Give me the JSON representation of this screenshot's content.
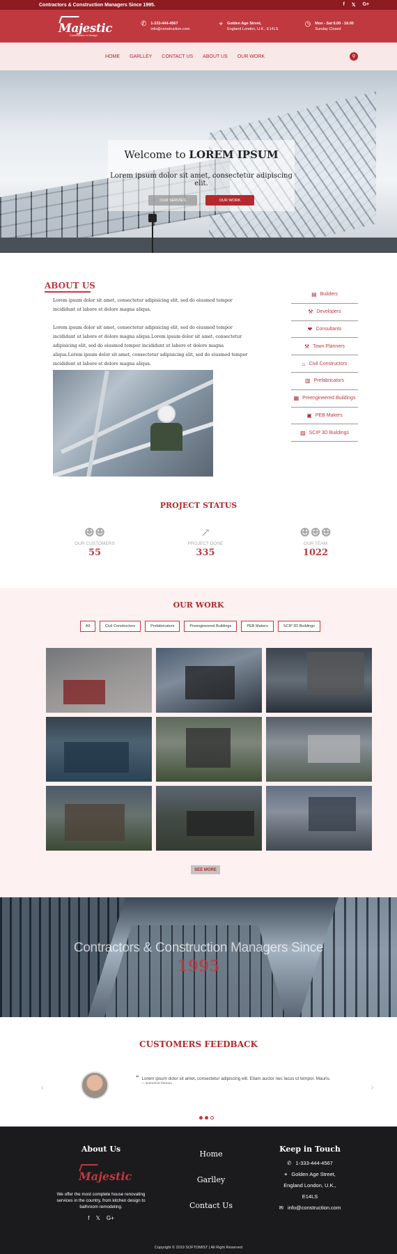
{
  "topbar": {
    "tagline": "Contractors & Construction Managers Since 1995.",
    "social": [
      "f",
      "𝕏",
      "G+"
    ]
  },
  "header": {
    "logo_text": "Majestic",
    "logo_sub": "Construction & Design",
    "phone": "1-333-444-4567",
    "email": "info@construction.com",
    "address_line1": "Golden Age Street,",
    "address_line2": "England London, U.K., E14LS",
    "hours_line1": "Mon - Sat 8.00 - 18.00",
    "hours_line2": "Sunday Closed",
    "icons": [
      "phone-icon",
      "map-pin-icon",
      "clock-icon"
    ]
  },
  "nav": {
    "items": [
      "HOME",
      "GARLLEY",
      "CONTACT US",
      "ABOUT US",
      "OUR WORK"
    ]
  },
  "hero": {
    "title_prefix": "Welcome to ",
    "title_bold": "LOREM IPSUM",
    "subtitle": "Lorem ipsum dolor sit amet, consectetur adipiscing elit.",
    "btn_services": "OUR SERVIES",
    "btn_work": "OUR WORK"
  },
  "about": {
    "title": "ABOUT US",
    "para1": "Lorem ipsum dolor sit amet, consectetur adipisicing elit, sed do eiusmod tempor incididunt ut labore et dolore magna aliqua.",
    "para2": "Lorem ipsum dolor sit amet, consectetur adipisicing elit, sed do eiusmod tempor incididunt ut labore et dolore magna aliqua.Lorem ipsum dolor sit amet, consectetur adipisicing elit, sed do eiusmod tempor incididunt ut labore et dolore magna aliqua.Lorem ipsum dolor sit amet, consectetur adipisicing elit, sed do eiusmod tempor incididunt ut labore et dolore magna aliqua.",
    "services": [
      {
        "label": "Builders",
        "icon": "building-icon",
        "glyph": "▤"
      },
      {
        "label": "Developers",
        "icon": "wrench-icon",
        "glyph": "⚒"
      },
      {
        "label": "Consultants",
        "icon": "handshake-icon",
        "glyph": "❤"
      },
      {
        "label": "Town Planners",
        "icon": "hammer-icon",
        "glyph": "⚒"
      },
      {
        "label": "Civil Constructors",
        "icon": "home-icon",
        "glyph": "⌂"
      },
      {
        "label": "Prefabricators",
        "icon": "city-icon",
        "glyph": "▥"
      },
      {
        "label": "Preengineered Buildings",
        "icon": "industry-icon",
        "glyph": "▦"
      },
      {
        "label": "PEB Makers",
        "icon": "university-icon",
        "glyph": "▣"
      },
      {
        "label": "SCIP 3D Buildings",
        "icon": "bus-icon",
        "glyph": "▧"
      }
    ]
  },
  "status": {
    "title": "PROJECT STATUS",
    "stats": [
      {
        "label": "OUR CUSTOMERS",
        "value": "55",
        "icon": "users-icon",
        "glyph": "☻☻"
      },
      {
        "label": "PROJECT DONE",
        "value": "335",
        "icon": "chart-icon",
        "glyph": "↗"
      },
      {
        "label": "OUR TEAM",
        "value": "1022",
        "icon": "team-icon",
        "glyph": "☻☻☻"
      }
    ]
  },
  "work": {
    "title": "OUR WORK",
    "filters": [
      "All",
      "Civil Constructors",
      "Prefabricators",
      "Preengineered Buildings",
      "PEB Makers",
      "SCIP 3D Buildings"
    ],
    "see_more": "SEE MORE",
    "tiles": [
      {
        "bg": "linear-gradient(160deg,#8d8f93 0%,#b9b7b5 50%,#d3d0cc 100%)",
        "accent": "#9b1c1f"
      },
      {
        "bg": "linear-gradient(160deg,#5c7189 0%,#9aaabb 40%,#2f3b48 100%)",
        "accent": "#222"
      },
      {
        "bg": "linear-gradient(180deg,#46505c 0%,#79848f 50%,#2d3540 100%)",
        "accent": "#666"
      },
      {
        "bg": "linear-gradient(180deg,#3b4b59 0%,#5a7587 40%,#2f4d63 100%)",
        "accent": "#1f3a4e"
      },
      {
        "bg": "linear-gradient(180deg,#6e7f6a 0%,#9aa394 40%,#4b5e3e 100%)",
        "accent": "#333"
      },
      {
        "bg": "linear-gradient(180deg,#66707c 0%,#a8b1ba 40%,#5e6e58 100%)",
        "accent": "#d9dcdf"
      },
      {
        "bg": "linear-gradient(180deg,#5a6b80 0%,#7d8a83 45%,#44553a 100%)",
        "accent": "#5a4a3c"
      },
      {
        "bg": "linear-gradient(180deg,#6c7a86 0%,#4d574f 50%,#3b4537 100%)",
        "accent": "#222"
      },
      {
        "bg": "linear-gradient(180deg,#7888a0 0%,#a5b0bd 40%,#4e5660 100%)",
        "accent": "#3a4451"
      }
    ]
  },
  "banner": {
    "text": "Contractors & Construction Managers Since",
    "year": "1995"
  },
  "feedback": {
    "title": "CUSTOMERS FEEDBACK",
    "quote": "Lorem ipsum dolor sit amet, consectetur adipiscing elit. Etiam auctor nec lacus ut tempor. Mauris.",
    "author": "— Someone famous",
    "quote_mark": "“",
    "prev": "‹",
    "next": "›"
  },
  "footer": {
    "about_title": "About Us",
    "about_text": "We offer the most complete house renovating services in the country, from kitchen design to bathroom remodeling.",
    "social": [
      "f",
      "𝕏",
      "G+"
    ],
    "links": [
      "Home",
      "Garlley",
      "Contact Us"
    ],
    "contact_title": "Keep in Touch",
    "phone": "1-333-444-4567",
    "address_line1": "Golden Age Street,",
    "address_line2": "England London, U.K., E14LS",
    "email": "info@construction.com",
    "copyright": "Copyright © 2019 SOFTOMIST | All Right Reserved"
  },
  "colors": {
    "brand_red": "#c0393f",
    "dark_red": "#8d1b22",
    "footer_bg": "#1b1b1d",
    "work_bg": "#fdf1f1"
  }
}
